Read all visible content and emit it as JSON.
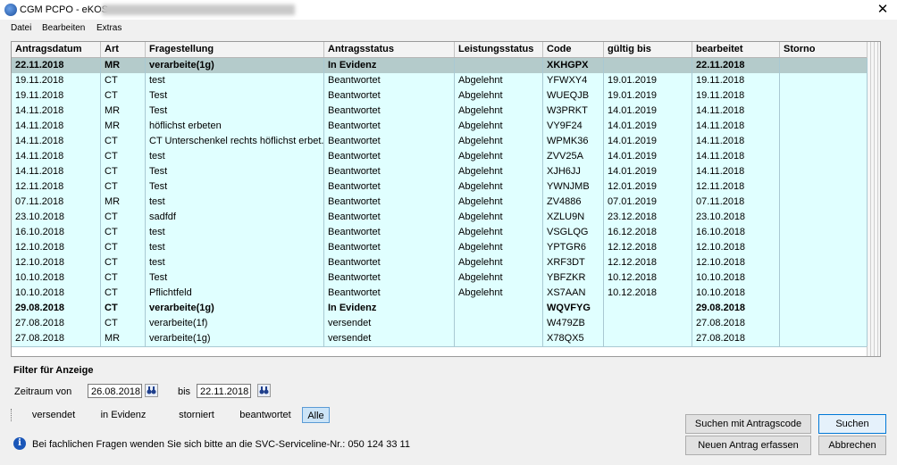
{
  "window": {
    "title": "CGM PCPO - eKOS -",
    "close_glyph": "✕"
  },
  "menu": [
    "Datei",
    "Bearbeiten",
    "Extras"
  ],
  "table": {
    "columns": [
      "Antragsdatum",
      "Art",
      "Fragestellung",
      "Antragsstatus",
      "Leistungsstatus",
      "Code",
      "gültig bis",
      "bearbeitet",
      "Storno"
    ],
    "rows": [
      [
        "22.11.2018",
        "MR",
        "verarbeite(1g)",
        "In Evidenz",
        "",
        "XKHGPX",
        "",
        "22.11.2018",
        ""
      ],
      [
        "19.11.2018",
        "CT",
        "test",
        "Beantwortet",
        "Abgelehnt",
        "YFWXY4",
        "19.01.2019",
        "19.11.2018",
        ""
      ],
      [
        "19.11.2018",
        "CT",
        "Test",
        "Beantwortet",
        "Abgelehnt",
        "WUEQJB",
        "19.01.2019",
        "19.11.2018",
        ""
      ],
      [
        "14.11.2018",
        "MR",
        "Test",
        "Beantwortet",
        "Abgelehnt",
        "W3PRKT",
        "14.01.2019",
        "14.11.2018",
        ""
      ],
      [
        "14.11.2018",
        "MR",
        "höflichst erbeten",
        "Beantwortet",
        "Abgelehnt",
        "VY9F24",
        "14.01.2019",
        "14.11.2018",
        ""
      ],
      [
        "14.11.2018",
        "CT",
        "CT Unterschenkel rechts höflichst erbet...",
        "Beantwortet",
        "Abgelehnt",
        "WPMK36",
        "14.01.2019",
        "14.11.2018",
        ""
      ],
      [
        "14.11.2018",
        "CT",
        "test",
        "Beantwortet",
        "Abgelehnt",
        "ZVV25A",
        "14.01.2019",
        "14.11.2018",
        ""
      ],
      [
        "14.11.2018",
        "CT",
        "Test",
        "Beantwortet",
        "Abgelehnt",
        "XJH6JJ",
        "14.01.2019",
        "14.11.2018",
        ""
      ],
      [
        "12.11.2018",
        "CT",
        "Test",
        "Beantwortet",
        "Abgelehnt",
        "YWNJMB",
        "12.01.2019",
        "12.11.2018",
        ""
      ],
      [
        "07.11.2018",
        "MR",
        "test",
        "Beantwortet",
        "Abgelehnt",
        "ZV4886",
        "07.01.2019",
        "07.11.2018",
        ""
      ],
      [
        "23.10.2018",
        "CT",
        "sadfdf",
        "Beantwortet",
        "Abgelehnt",
        "XZLU9N",
        "23.12.2018",
        "23.10.2018",
        ""
      ],
      [
        "16.10.2018",
        "CT",
        "test",
        "Beantwortet",
        "Abgelehnt",
        "VSGLQG",
        "16.12.2018",
        "16.10.2018",
        ""
      ],
      [
        "12.10.2018",
        "CT",
        "test",
        "Beantwortet",
        "Abgelehnt",
        "YPTGR6",
        "12.12.2018",
        "12.10.2018",
        ""
      ],
      [
        "12.10.2018",
        "CT",
        "test",
        "Beantwortet",
        "Abgelehnt",
        "XRF3DT",
        "12.12.2018",
        "12.10.2018",
        ""
      ],
      [
        "10.10.2018",
        "CT",
        "Test",
        "Beantwortet",
        "Abgelehnt",
        "YBFZKR",
        "10.12.2018",
        "10.10.2018",
        ""
      ],
      [
        "10.10.2018",
        "CT",
        "Pflichtfeld",
        "Beantwortet",
        "Abgelehnt",
        "XS7AAN",
        "10.12.2018",
        "10.10.2018",
        ""
      ],
      [
        "29.08.2018",
        "CT",
        "verarbeite(1g)",
        "In Evidenz",
        "",
        "WQVFYG",
        "",
        "29.08.2018",
        ""
      ],
      [
        "27.08.2018",
        "CT",
        "verarbeite(1f)",
        "versendet",
        "",
        "W479ZB",
        "",
        "27.08.2018",
        ""
      ],
      [
        "27.08.2018",
        "MR",
        "verarbeite(1g)",
        "versendet",
        "",
        "X78QX5",
        "",
        "27.08.2018",
        ""
      ]
    ],
    "bold_rows": [
      0,
      16
    ],
    "highlight_row": 0
  },
  "filter": {
    "title": "Filter für Anzeige",
    "zeitraum_label": "Zeitraum von",
    "from_date": "26.08.2018",
    "bis_label": "bis",
    "to_date": "22.11.2018",
    "status_options": [
      "versendet",
      "in Evidenz",
      "storniert",
      "beantwortet",
      "Alle"
    ],
    "active_status": "Alle"
  },
  "buttons": {
    "search_by_code": "Suchen mit Antragscode",
    "search": "Suchen",
    "new_request": "Neuen Antrag erfassen",
    "cancel": "Abbrechen"
  },
  "info": {
    "text": "Bei fachlichen Fragen wenden Sie sich bitte an die SVC-Serviceline-Nr.: 050 124 33 11"
  },
  "colors": {
    "row_bg": "#e0ffff",
    "selected_row_bg": "#b4cbcb"
  }
}
